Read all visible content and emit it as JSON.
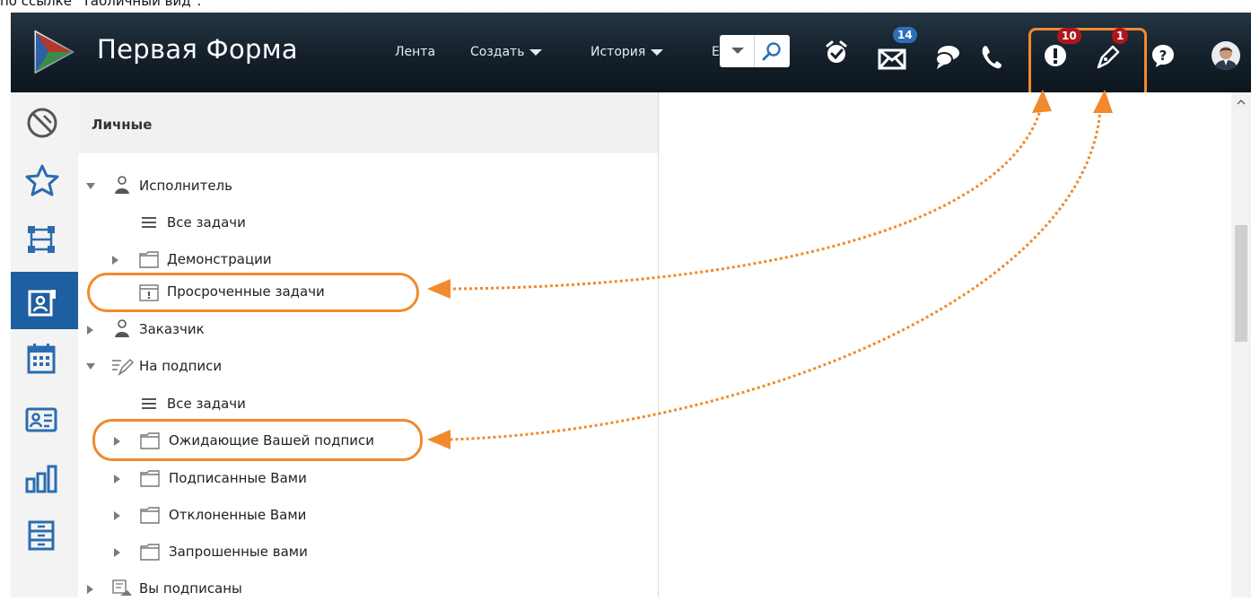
{
  "caption": "по ссылке \"Табличный вид\".",
  "header": {
    "brand": "Первая Форма",
    "nav": [
      {
        "label": "Лента",
        "has_menu": false
      },
      {
        "label": "Создать",
        "has_menu": true
      },
      {
        "label": "История",
        "has_menu": true
      },
      {
        "label": "Е",
        "has_menu": false
      }
    ],
    "badges": {
      "mail": "14",
      "alerts": "10",
      "signatures": "1"
    },
    "icons": [
      "logo-icon",
      "search-icon",
      "alarm-clock-icon",
      "mail-icon",
      "chat-icon",
      "phone-icon",
      "exclamation-icon",
      "pen-icon",
      "help-icon",
      "avatar"
    ]
  },
  "rail": {
    "items": [
      {
        "name": "unpin-icon",
        "active": false
      },
      {
        "name": "star-icon",
        "active": false
      },
      {
        "name": "structure-icon",
        "active": false
      },
      {
        "name": "personal-tasks-icon",
        "active": true
      },
      {
        "name": "calendar-icon",
        "active": false
      },
      {
        "name": "contact-card-icon",
        "active": false
      },
      {
        "name": "chart-icon",
        "active": false
      },
      {
        "name": "cabinet-icon",
        "active": false
      }
    ]
  },
  "panel": {
    "title": "Личные",
    "tree": {
      "executor": "Исполнитель",
      "executor_all": "Все задачи",
      "executor_demo": "Демонстрации",
      "executor_overdue": "Просроченные задачи",
      "customer": "Заказчик",
      "signing": "На подписи",
      "signing_all": "Все задачи",
      "signing_waiting": "Ожидающие Вашей подписи",
      "signing_signed": "Подписанные Вами",
      "signing_rejected": "Отклоненные Вами",
      "signing_requested": "Запрошенные вами",
      "subscribed": "Вы подписаны"
    }
  },
  "colors": {
    "topbar": "#14202b",
    "accent_orange": "#f08a2c",
    "rail_active": "#1d5fa0",
    "badge_red": "#b0161b",
    "badge_blue": "#2d6fb8"
  }
}
